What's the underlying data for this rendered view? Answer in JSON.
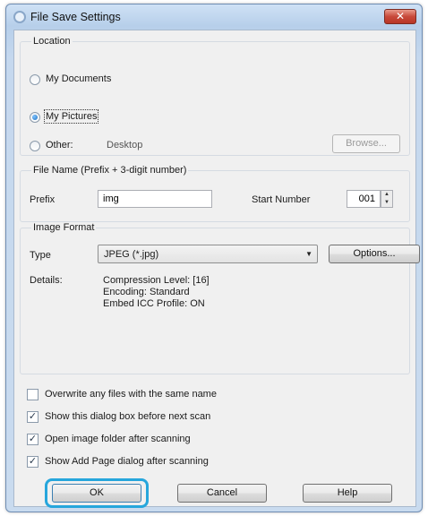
{
  "window": {
    "title": "File Save Settings",
    "close_glyph": "✕"
  },
  "location": {
    "label": "Location",
    "options": {
      "my_documents": "My Documents",
      "my_pictures": "My Pictures",
      "other": "Other:"
    },
    "selected": "My Pictures",
    "other_path": "Desktop",
    "browse_label": "Browse..."
  },
  "file_name": {
    "label": "File Name (Prefix + 3-digit number)",
    "prefix_label": "Prefix",
    "prefix_value": "img",
    "start_number_label": "Start Number",
    "start_number_value": "001"
  },
  "image_format": {
    "label": "Image Format",
    "type_label": "Type",
    "type_value": "JPEG (*.jpg)",
    "options_label": "Options...",
    "details_label": "Details:",
    "details": [
      "Compression Level: [16]",
      "Encoding: Standard",
      "Embed ICC Profile: ON"
    ]
  },
  "checkboxes": [
    {
      "label": "Overwrite any files with the same name",
      "checked": false
    },
    {
      "label": "Show this dialog box before next scan",
      "checked": true
    },
    {
      "label": "Open image folder after scanning",
      "checked": true
    },
    {
      "label": "Show Add Page dialog after scanning",
      "checked": true
    }
  ],
  "buttons": {
    "ok": "OK",
    "cancel": "Cancel",
    "help": "Help"
  },
  "colors": {
    "highlight": "#26a6dc",
    "close": "#c8493a",
    "title_bar": "#b7cfea"
  },
  "icons": {
    "title": "scanner-icon",
    "close": "close-icon",
    "dropdown": "chevron-down-icon"
  }
}
